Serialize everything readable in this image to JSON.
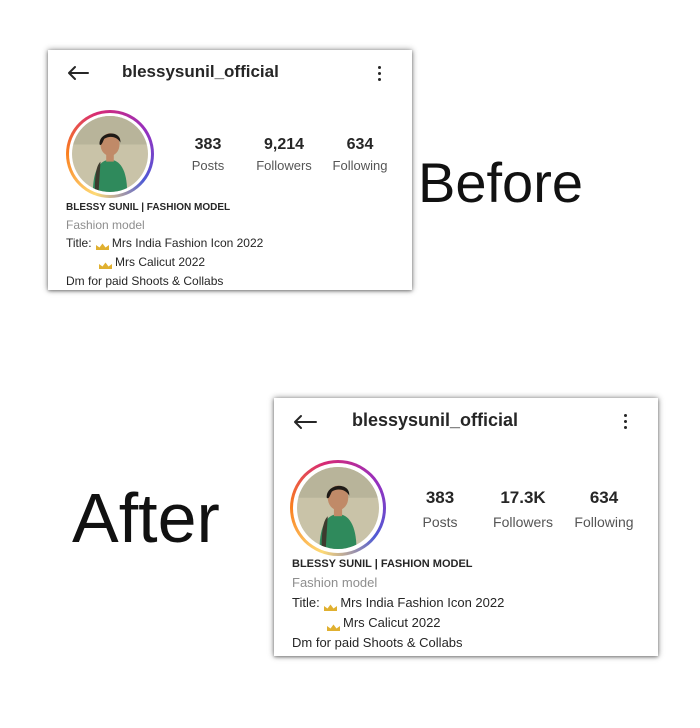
{
  "before": {
    "label": "Before",
    "profile": {
      "username": "blessysunil_official",
      "stats": [
        {
          "num": "383",
          "label": "Posts"
        },
        {
          "num": "9,214",
          "label": "Followers"
        },
        {
          "num": "634",
          "label": "Following"
        }
      ],
      "name": "BLESSY SUNIL | FASHION MODEL",
      "category": "Fashion model",
      "bio_title_prefix": "Title: ",
      "bio_title": "Mrs India Fashion Icon 2022",
      "bio_title2": "Mrs Calicut 2022",
      "bio_dm": "Dm for paid Shoots & Collabs"
    }
  },
  "after": {
    "label": "After",
    "profile": {
      "username": "blessysunil_official",
      "stats": [
        {
          "num": "383",
          "label": "Posts"
        },
        {
          "num": "17.3K",
          "label": "Followers"
        },
        {
          "num": "634",
          "label": "Following"
        }
      ],
      "name": "BLESSY SUNIL | FASHION MODEL",
      "category": "Fashion model",
      "bio_title_prefix": "Title: ",
      "bio_title": "Mrs India Fashion Icon 2022",
      "bio_title2": "Mrs Calicut 2022",
      "bio_dm": "Dm for paid Shoots & Collabs"
    }
  },
  "icons": {
    "back": "arrow-left-icon",
    "more": "vertical-ellipsis-icon",
    "crown": "crown-icon"
  },
  "colors": {
    "text": "#262626",
    "muted": "#8e8e8e",
    "story_ring": [
      "#feda75",
      "#fa7e1e",
      "#d62976",
      "#962fbf",
      "#4f5bd5"
    ],
    "avatar_dress": "#2f8a5c"
  }
}
